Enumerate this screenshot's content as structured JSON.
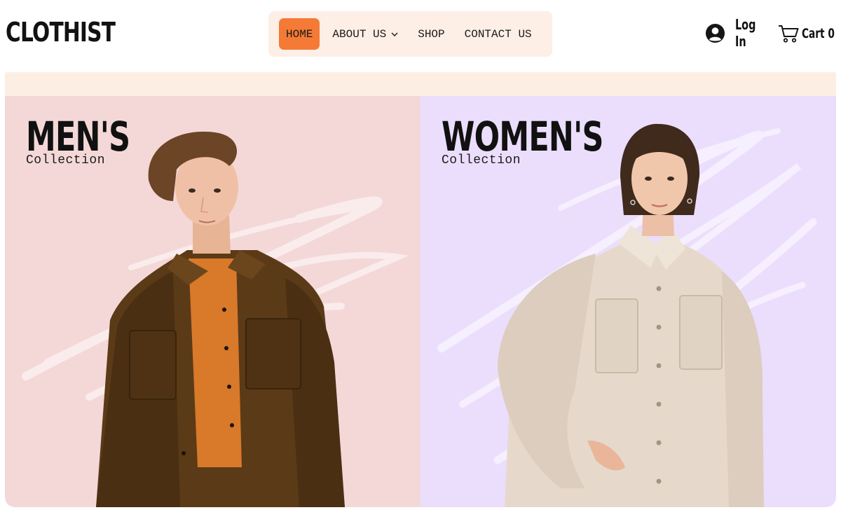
{
  "brand": {
    "logo": "CLOTHIST"
  },
  "nav": {
    "items": [
      {
        "label": "HOME",
        "active": true
      },
      {
        "label": "ABOUT US",
        "has_dropdown": true
      },
      {
        "label": "SHOP"
      },
      {
        "label": "CONTACT US"
      }
    ],
    "background": "#fdefe6",
    "active_color": "#f47a35"
  },
  "account": {
    "login_label": "Log In",
    "cart_label": "Cart",
    "cart_count": "0"
  },
  "collections": [
    {
      "title": "MEN'S",
      "subtitle": "Collection",
      "background": "#f4d8d8"
    },
    {
      "title": "WOMEN'S",
      "subtitle": "Collection",
      "background": "#ebdefc"
    }
  ],
  "icons": {
    "user": "user-circle-icon",
    "cart": "shopping-cart-icon",
    "dropdown": "chevron-down-icon"
  }
}
